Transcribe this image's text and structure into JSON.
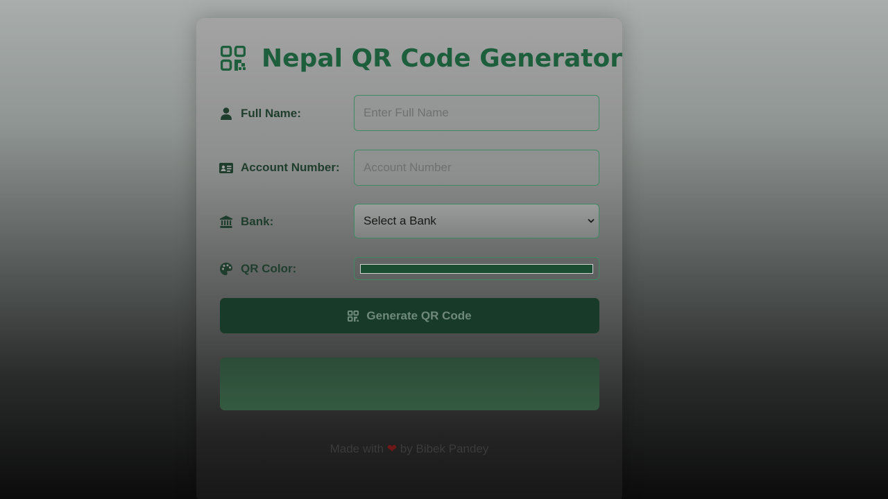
{
  "header": {
    "title": "Nepal QR Code Generator",
    "logo_icon": "qrcode-icon"
  },
  "form": {
    "full_name": {
      "label": "Full Name:",
      "icon": "user-icon",
      "placeholder": "Enter Full Name",
      "value": ""
    },
    "account_number": {
      "label": "Account Number:",
      "icon": "id-card-icon",
      "placeholder": "Account Number",
      "value": ""
    },
    "bank": {
      "label": "Bank:",
      "icon": "bank-icon",
      "selected": "Select a Bank"
    },
    "qr_color": {
      "label": "QR Color:",
      "icon": "palette-icon",
      "value": "#1b4d32"
    },
    "generate_label": "Generate QR Code"
  },
  "footer": {
    "prefix": "Made with",
    "heart": "❤",
    "suffix": "by Bibek Pandey"
  },
  "colors": {
    "accent": "#1d5e3c",
    "button": "#173b28",
    "border": "#3f8a63"
  }
}
